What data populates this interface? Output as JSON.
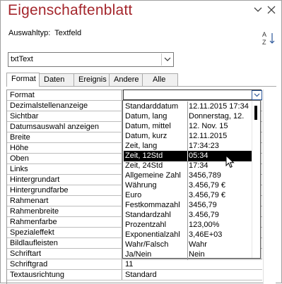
{
  "pane": {
    "title": "Eigenschaftenblatt",
    "selection_type_label": "Auswahltyp:",
    "selection_type_value": "Textfeld"
  },
  "object_combo": {
    "value": "txtText"
  },
  "tabs": [
    {
      "label": "Format",
      "active": true
    },
    {
      "label": "Daten",
      "active": false
    },
    {
      "label": "Ereignis",
      "active": false
    },
    {
      "label": "Andere",
      "active": false
    },
    {
      "label": "Alle",
      "active": false
    }
  ],
  "properties": [
    {
      "name": "Format",
      "value": ""
    },
    {
      "name": "Dezimalstellenanzeige",
      "value": ""
    },
    {
      "name": "Sichtbar",
      "value": ""
    },
    {
      "name": "Datumsauswahl anzeigen",
      "value": ""
    },
    {
      "name": "Breite",
      "value": ""
    },
    {
      "name": "Höhe",
      "value": ""
    },
    {
      "name": "Oben",
      "value": ""
    },
    {
      "name": "Links",
      "value": ""
    },
    {
      "name": "Hintergrundart",
      "value": ""
    },
    {
      "name": "Hintergrundfarbe",
      "value": ""
    },
    {
      "name": "Rahmenart",
      "value": ""
    },
    {
      "name": "Rahmenbreite",
      "value": ""
    },
    {
      "name": "Rahmenfarbe",
      "value": ""
    },
    {
      "name": "Spezialeffekt",
      "value": ""
    },
    {
      "name": "Bildlaufleisten",
      "value": ""
    },
    {
      "name": "Schriftart",
      "value": ""
    },
    {
      "name": "Schriftgrad",
      "value": "11"
    },
    {
      "name": "Textausrichtung",
      "value": "Standard"
    }
  ],
  "format_dropdown": {
    "selected_index": 5,
    "options": [
      {
        "name": "Standarddatum",
        "example": "12.11.2015 17:34"
      },
      {
        "name": "Datum, lang",
        "example": "Donnerstag, 12."
      },
      {
        "name": "Datum, mittel",
        "example": "12. Nov. 15"
      },
      {
        "name": "Datum, kurz",
        "example": "12.11.2015"
      },
      {
        "name": "Zeit, lang",
        "example": "17:34:23"
      },
      {
        "name": "Zeit, 12Std",
        "example": "05:34"
      },
      {
        "name": "Zeit, 24Std",
        "example": "17:34"
      },
      {
        "name": "Allgemeine Zahl",
        "example": "3456,789"
      },
      {
        "name": "Währung",
        "example": "3.456,79 €"
      },
      {
        "name": "Euro",
        "example": "3.456,79 €"
      },
      {
        "name": "Festkommazahl",
        "example": "3456,79"
      },
      {
        "name": "Standardzahl",
        "example": "3.456,79"
      },
      {
        "name": "Prozentzahl",
        "example": "123,00%"
      },
      {
        "name": "Exponentialzahl",
        "example": "3,46E+03"
      },
      {
        "name": "Wahr/Falsch",
        "example": "Wahr"
      },
      {
        "name": "Ja/Nein",
        "example": "Nein"
      }
    ]
  },
  "colors": {
    "title": "#a4262c",
    "selection": "#000000",
    "dropdown_border": "#2b579a"
  },
  "icons": {
    "chevron": "chevron-down-icon",
    "close": "close-icon",
    "sort": "sort-az-icon",
    "cursor": "mouse-pointer-icon"
  }
}
